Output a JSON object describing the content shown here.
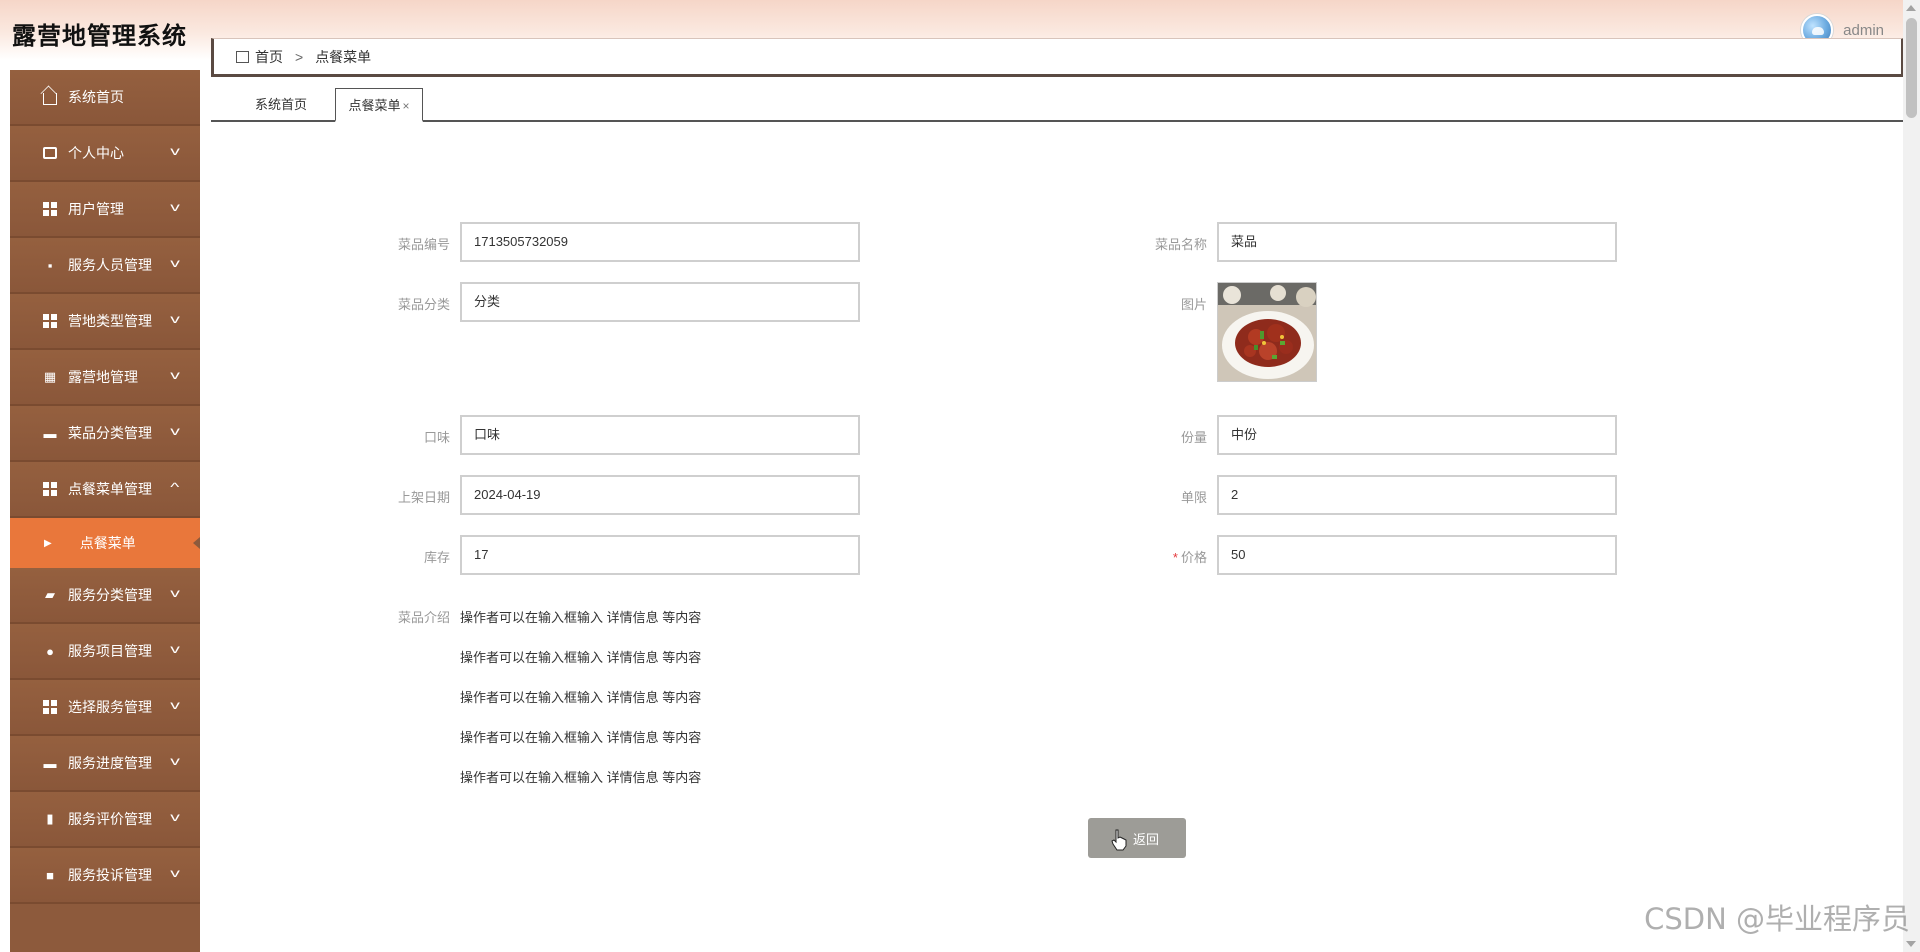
{
  "app": {
    "title": "露营地管理系统",
    "user": "admin"
  },
  "breadcrumb": {
    "home": "首页",
    "current": "点餐菜单"
  },
  "tabs": [
    {
      "label": "系统首页"
    },
    {
      "label": "点餐菜单",
      "close": "×"
    }
  ],
  "sidebar": {
    "items": [
      {
        "label": "系统首页",
        "icon": "home-icon"
      },
      {
        "label": "个人中心",
        "icon": "card-icon"
      },
      {
        "label": "用户管理",
        "icon": "grid-icon"
      },
      {
        "label": "服务人员管理",
        "icon": "chat-icon"
      },
      {
        "label": "营地类型管理",
        "icon": "grid-icon"
      },
      {
        "label": "露营地管理",
        "icon": "table-icon"
      },
      {
        "label": "菜品分类管理",
        "icon": "ticket-icon"
      },
      {
        "label": "点餐菜单管理",
        "icon": "grid-icon"
      },
      {
        "label": "服务分类管理",
        "icon": "hand-icon"
      },
      {
        "label": "服务项目管理",
        "icon": "bulb-icon"
      },
      {
        "label": "选择服务管理",
        "icon": "grid-icon"
      },
      {
        "label": "服务进度管理",
        "icon": "monitor-icon"
      },
      {
        "label": "服务评价管理",
        "icon": "book-icon"
      },
      {
        "label": "服务投诉管理",
        "icon": "briefcase-icon"
      }
    ],
    "sub_active": "点餐菜单"
  },
  "form": {
    "dish_no_label": "菜品编号",
    "dish_no": "1713505732059",
    "dish_name_label": "菜品名称",
    "dish_name": "菜品",
    "category_label": "菜品分类",
    "category": "分类",
    "image_label": "图片",
    "taste_label": "口味",
    "taste": "口味",
    "portion_label": "份量",
    "portion": "中份",
    "date_label": "上架日期",
    "date": "2024-04-19",
    "limit_label": "单限",
    "limit": "2",
    "stock_label": "库存",
    "stock": "17",
    "price_req": "*",
    "price_label": "价格",
    "price": "50",
    "intro_label": "菜品介绍",
    "intro_lines": [
      "操作者可以在输入框输入 详情信息 等内容",
      "操作者可以在输入框输入 详情信息 等内容",
      "操作者可以在输入框输入 详情信息 等内容",
      "操作者可以在输入框输入 详情信息 等内容",
      "操作者可以在输入框输入 详情信息 等内容"
    ],
    "back_label": "返回"
  },
  "watermark": "CSDN @毕业程序员",
  "colors": {
    "sidebar_bg": "#8d5a3c",
    "sidebar_active": "#e9773b",
    "back_button": "#9d9c97",
    "required": "#e4393c"
  }
}
